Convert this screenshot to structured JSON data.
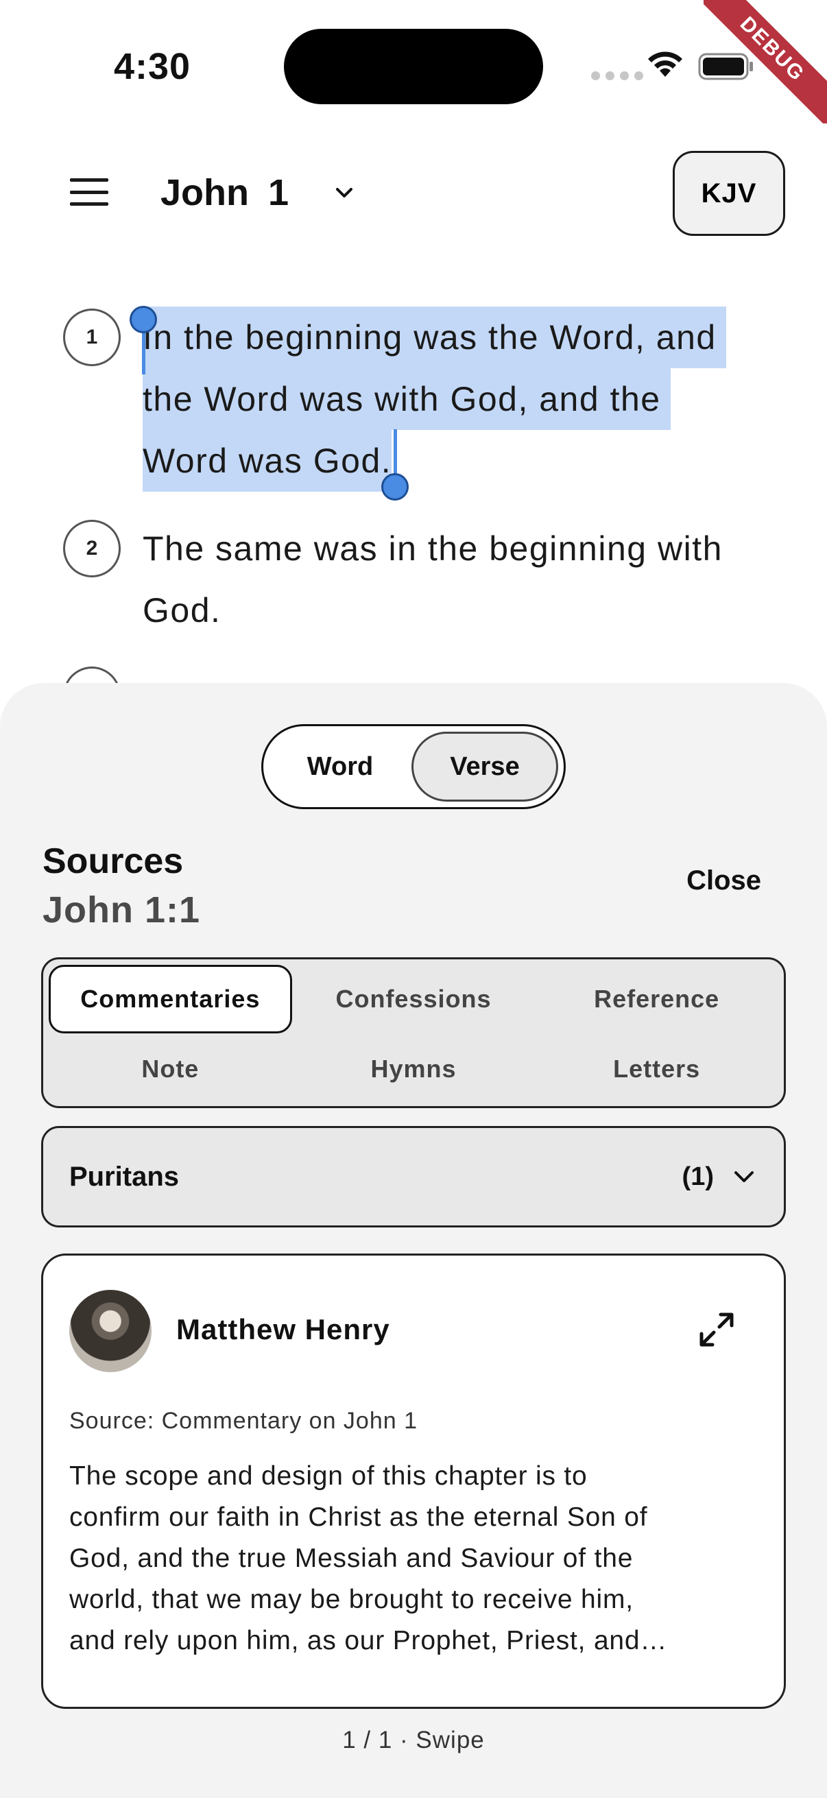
{
  "status_bar": {
    "time": "4:30",
    "debug_label": "DEBUG"
  },
  "header": {
    "book": "John",
    "chapter": "1",
    "version": "KJV"
  },
  "verses": [
    {
      "number": "1",
      "lines": [
        "In the beginning was the Word, and",
        "the Word was with God, and the",
        "Word was God."
      ]
    },
    {
      "number": "2",
      "lines": [
        "The same was in the beginning with",
        "God."
      ]
    }
  ],
  "sheet": {
    "toggle": [
      "Word",
      "Verse"
    ],
    "toggle_selected": "Verse",
    "title": "Sources",
    "reference": "John 1:1",
    "close_label": "Close",
    "tabs": [
      "Commentaries",
      "Confessions",
      "Reference",
      "Note",
      "Hymns",
      "Letters"
    ],
    "tab_selected": "Commentaries",
    "dropdown": {
      "label": "Puritans",
      "count": "(1)"
    },
    "card": {
      "author": "Matthew Henry",
      "source": "Source: Commentary on John 1",
      "excerpt_lines": [
        "The scope and design of this chapter is to",
        "confirm our faith in Christ as the eternal Son of",
        "God, and the true Messiah and Saviour of the",
        "world, that we may be brought to receive him,",
        "and rely upon him, as our Prophet, Priest, and…"
      ]
    },
    "pager": "1 / 1 · Swipe"
  },
  "icons": {
    "menu": "menu-icon",
    "chevron": "chevron-down-icon",
    "expand": "expand-icon",
    "wifi": "wifi-icon",
    "battery": "battery-icon"
  },
  "colors": {
    "selection": "#c3d8f6",
    "handle": "#4a8be3",
    "sheet_bg": "#f3f3f3",
    "debug": "#b7333f"
  }
}
